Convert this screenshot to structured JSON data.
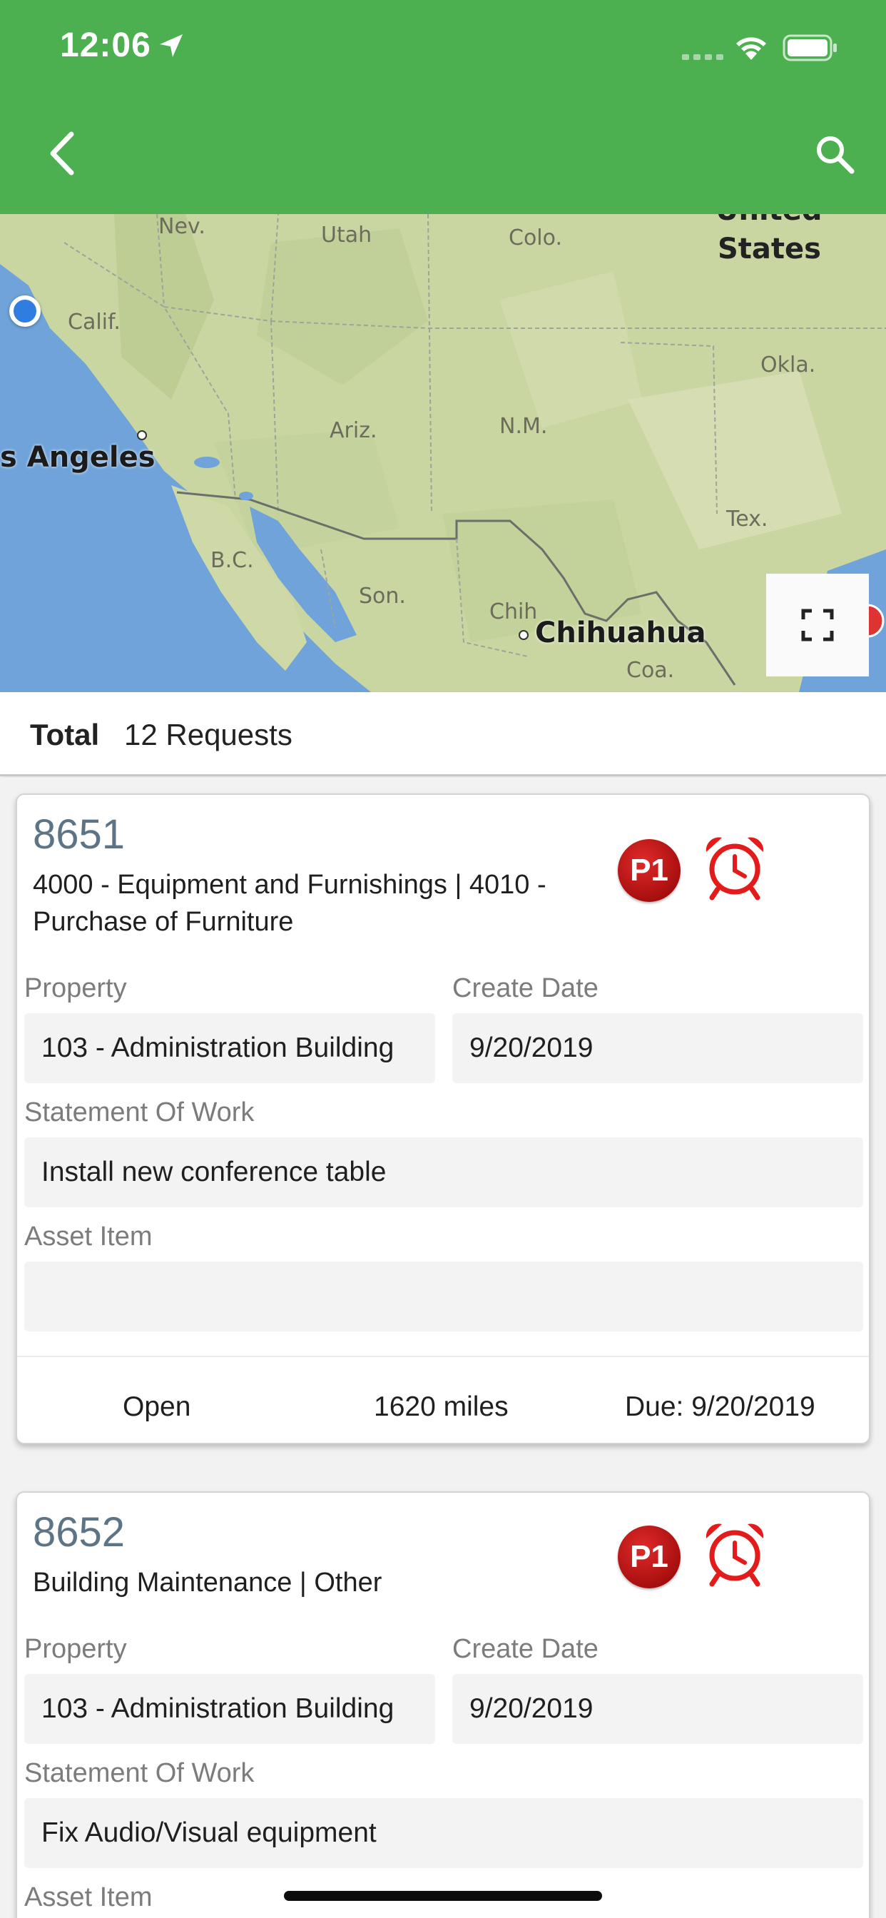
{
  "status_bar": {
    "time": "12:06"
  },
  "header": {
    "back_icon": "chevron-left-icon",
    "search_icon": "search-icon",
    "color": "#4caf50"
  },
  "map": {
    "labels": {
      "nev": "Nev.",
      "utah": "Utah",
      "colo": "Colo.",
      "united": "United",
      "states": "States",
      "calif": "Calif.",
      "okla": "Okla.",
      "ariz": "Ariz.",
      "nm": "N.M.",
      "los_angeles": "s Angeles",
      "tex": "Tex.",
      "bc": "B.C.",
      "son": "Son.",
      "chih": "Chih",
      "chihuahua": "Chihuahua",
      "coa": "Coa."
    },
    "expand_icon": "expand-icon"
  },
  "summary": {
    "label": "Total",
    "value": "12 Requests"
  },
  "requests": [
    {
      "id": "8651",
      "category": "4000 - Equipment and Furnishings | 4010 - Purchase of Furniture",
      "priority": "P1",
      "property_label": "Property",
      "property": "103 - Administration Building",
      "create_date_label": "Create Date",
      "create_date": "9/20/2019",
      "sow_label": "Statement Of Work",
      "sow": "Install new conference table",
      "asset_label": "Asset Item",
      "asset": "",
      "status": "Open",
      "distance": "1620 miles",
      "due": "Due: 9/20/2019"
    },
    {
      "id": "8652",
      "category": "Building Maintenance | Other",
      "priority": "P1",
      "property_label": "Property",
      "property": "103 - Administration Building",
      "create_date_label": "Create Date",
      "create_date": "9/20/2019",
      "sow_label": "Statement Of Work",
      "sow": "Fix Audio/Visual equipment",
      "asset_label": "Asset Item"
    }
  ]
}
